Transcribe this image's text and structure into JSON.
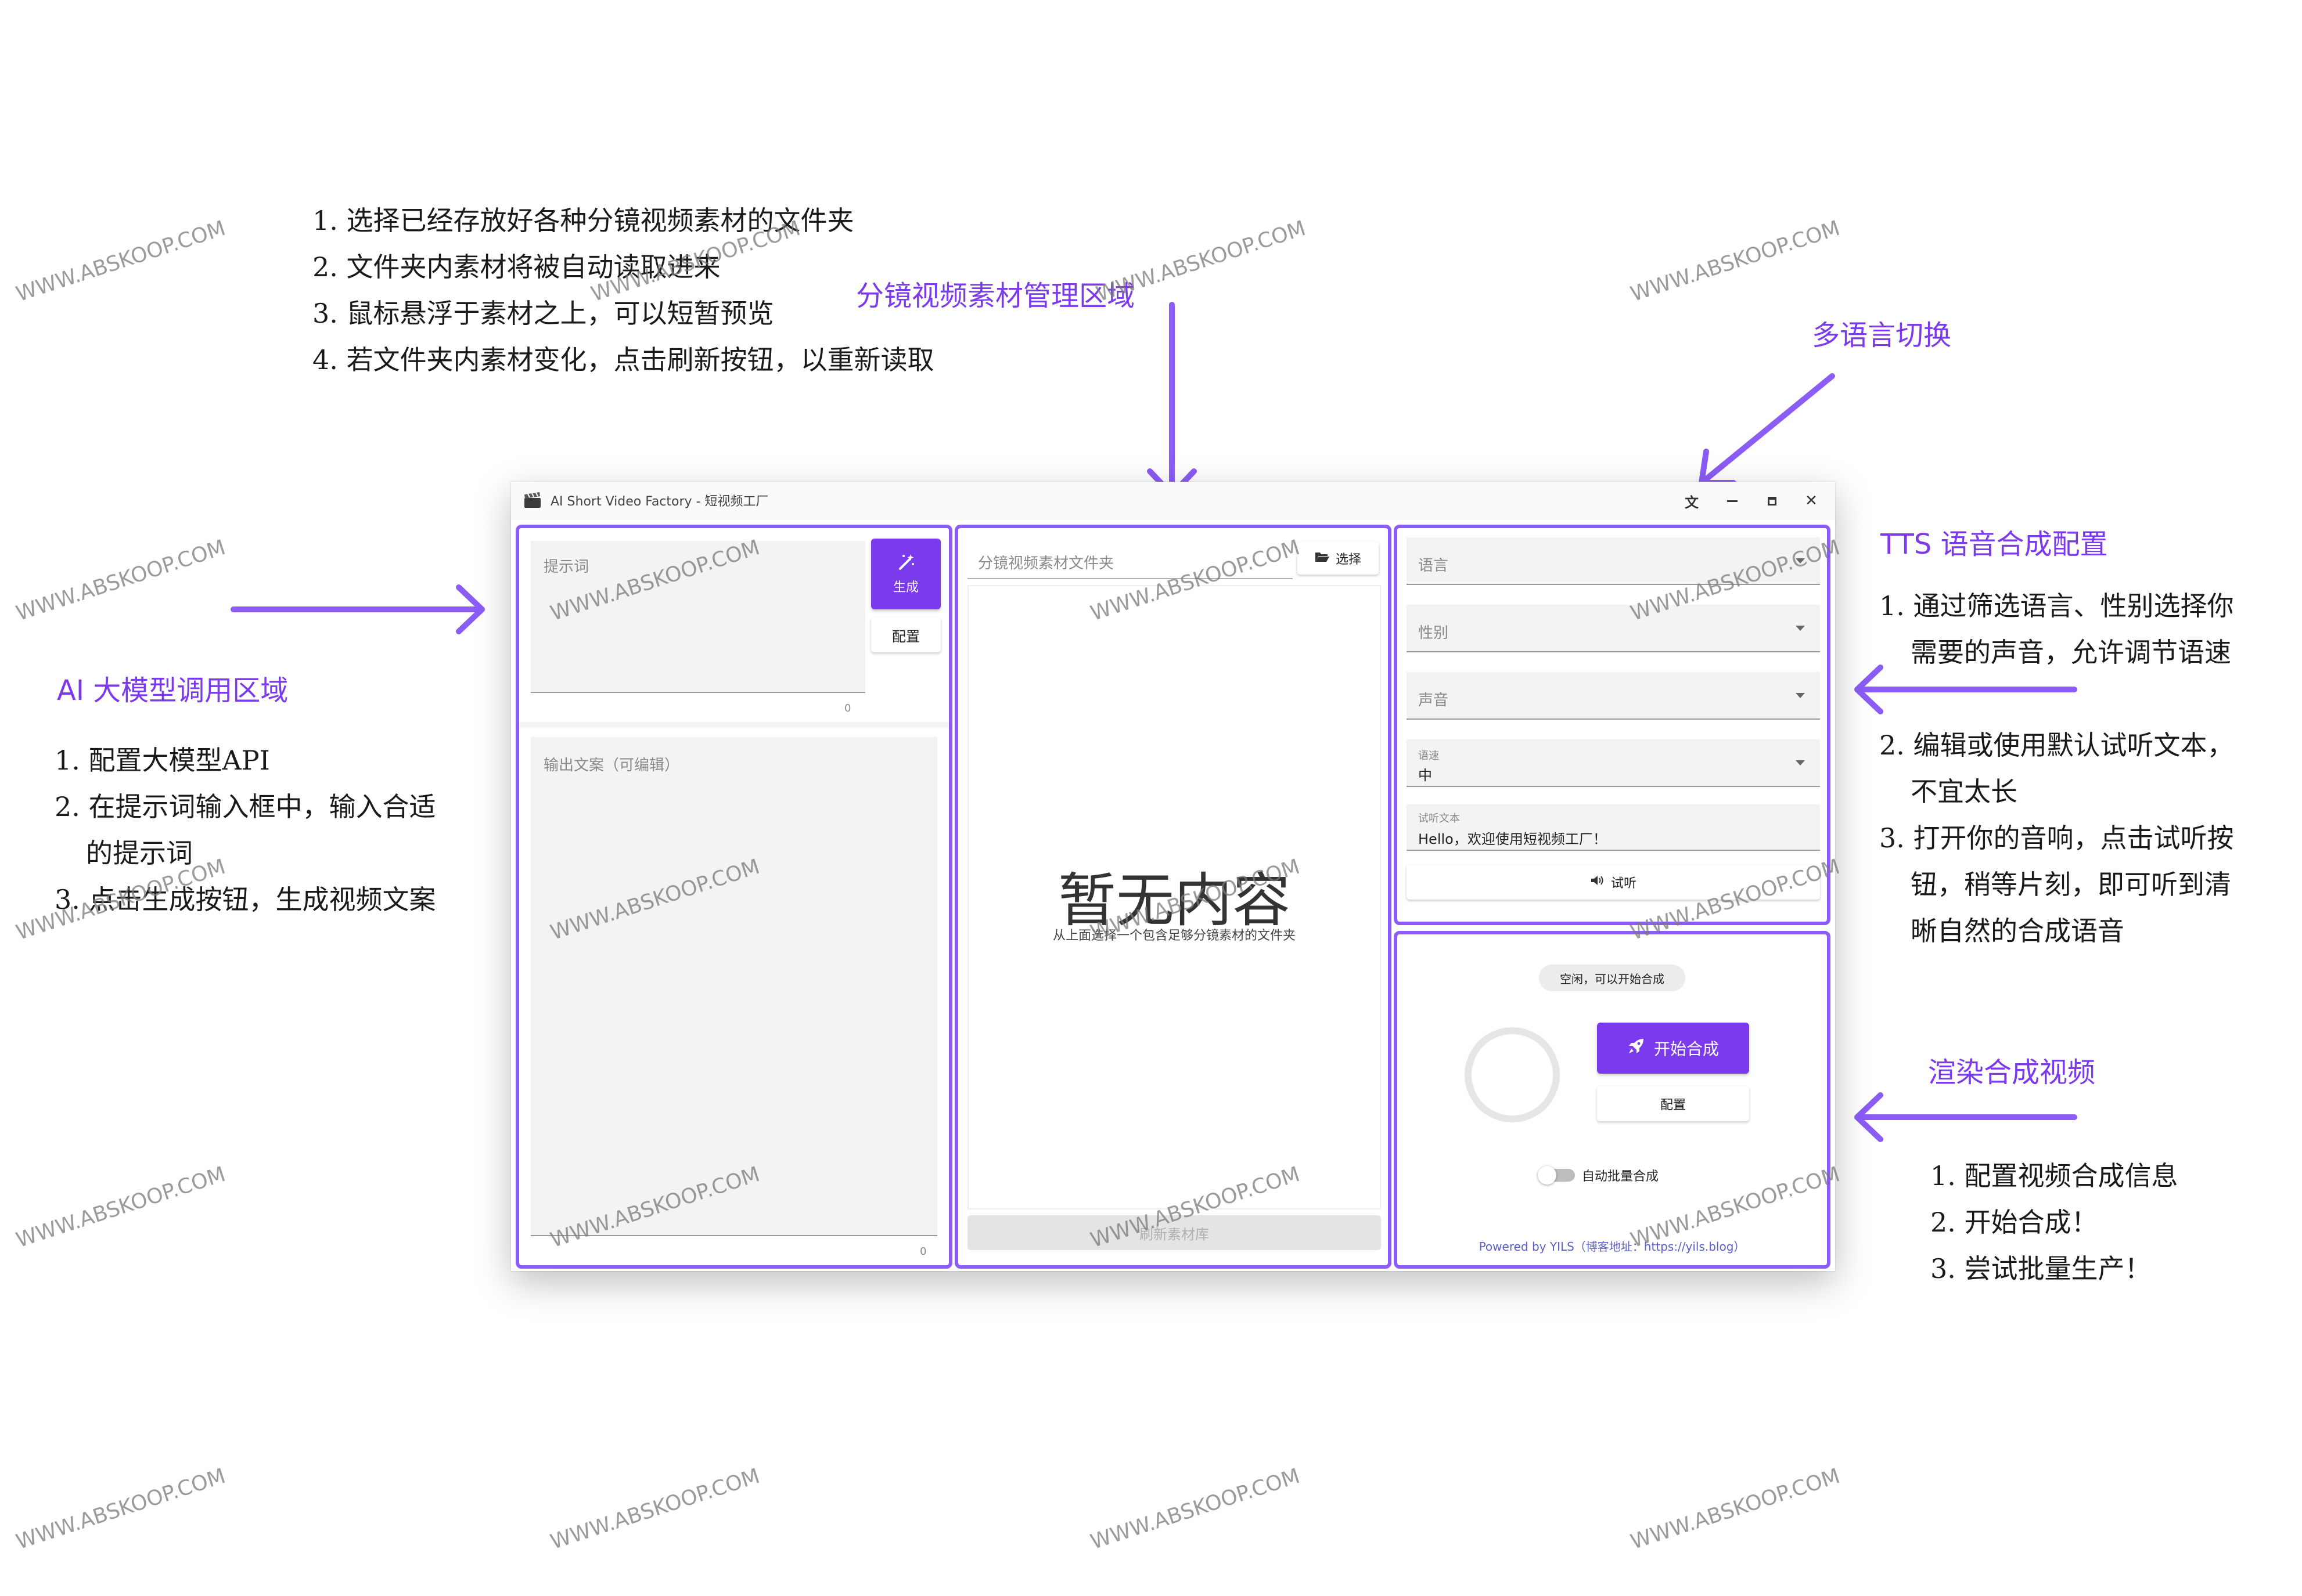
{
  "annotations": {
    "materials_notes": [
      "1. 选择已经存放好各种分镜视频素材的文件夹",
      "2. 文件夹内素材将被自动读取进来",
      "3. 鼠标悬浮于素材之上，可以短暂预览",
      "4. 若文件夹内素材变化，点击刷新按钮，以重新读取"
    ],
    "materials_title": "分镜视频素材管理区域",
    "language_title": "多语言切换",
    "llm_title": "AI 大模型调用区域",
    "llm_notes": [
      "1. 配置大模型API",
      "2. 在提示词输入框中，输入合适",
      "的提示词",
      "3. 点击生成按钮，生成视频文案"
    ],
    "tts_title": "TTS 语音合成配置",
    "tts_notes": [
      "1. 通过筛选语言、性别选择你",
      "需要的声音，允许调节语速",
      "2. 编辑或使用默认试听文本，",
      "不宜太长",
      "3. 打开你的音响，点击试听按",
      "钮，稍等片刻，即可听到清",
      "晰自然的合成语音"
    ],
    "render_title": "渲染合成视频",
    "render_notes": [
      "1. 配置视频合成信息",
      "2. 开始合成！",
      "3. 尝试批量生产！"
    ],
    "watermark": "WWW.ABSKOOP.COM"
  },
  "window": {
    "title": "AI Short Video Factory - 短视频工厂",
    "icons": {
      "app": "clapperboard-icon",
      "translate": "translate-icon",
      "minimize": "minimize-icon",
      "maximize": "maximize-icon",
      "close": "close-icon"
    }
  },
  "llm_panel": {
    "prompt_label": "提示词",
    "prompt_counter": "0",
    "generate_label": "生成",
    "config_label": "配置",
    "output_label": "输出文案（可编辑）",
    "output_counter": "0"
  },
  "materials_panel": {
    "folder_placeholder": "分镜视频素材文件夹",
    "select_label": "选择",
    "empty_title": "暂无内容",
    "empty_subtitle": "从上面选择一个包含足够分镜素材的文件夹",
    "refresh_label": "刷新素材库"
  },
  "tts_panel": {
    "language_label": "语言",
    "gender_label": "性别",
    "voice_label": "声音",
    "speed_label": "语速",
    "speed_value": "中",
    "preview_text_label": "试听文本",
    "preview_text_value": "Hello，欢迎使用短视频工厂！",
    "preview_button": "试听"
  },
  "render_panel": {
    "status": "空闲，可以开始合成",
    "start_label": "开始合成",
    "config_label": "配置",
    "auto_batch_label": "自动批量合成",
    "auto_batch_enabled": false,
    "progress": 0,
    "footer": "Powered by YILS（博客地址：https://yils.blog）"
  },
  "colors": {
    "accent": "#7c3aed",
    "highlight_border": "#8b5cf6"
  }
}
